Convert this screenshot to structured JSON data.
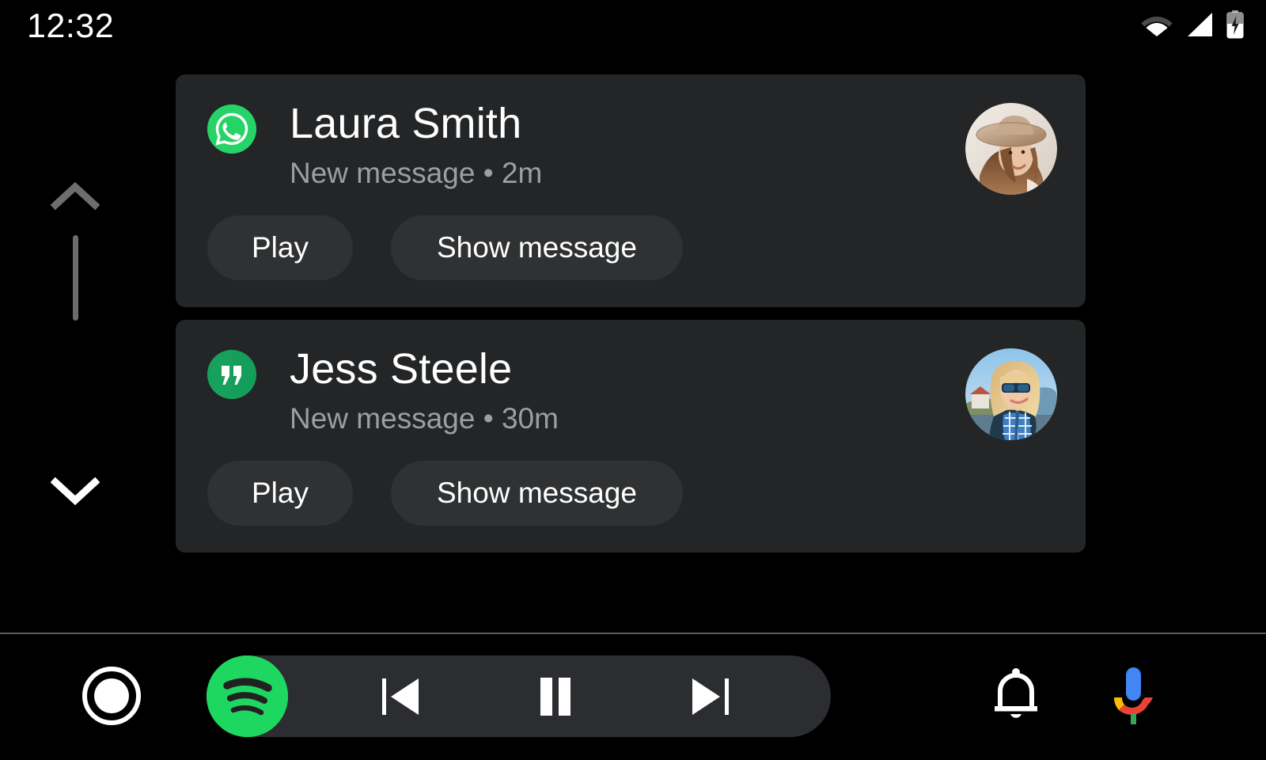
{
  "status_bar": {
    "time": "12:32",
    "icons": [
      {
        "name": "wifi-icon",
        "label": "Wi-Fi"
      },
      {
        "name": "cellular-signal-icon",
        "label": "Cellular signal"
      },
      {
        "name": "battery-charging-icon",
        "label": "Battery charging"
      }
    ]
  },
  "scroll": {
    "up_icon": "chevron-up-icon",
    "down_icon": "chevron-down-icon",
    "up_enabled": false,
    "down_enabled": true
  },
  "notifications": [
    {
      "sender": "Laura Smith",
      "subtitle": "New message • 2m",
      "status": "New message",
      "time": "2m",
      "app": "whatsapp",
      "app_icon": "whatsapp-icon",
      "app_color": "#25D366",
      "avatar_name": "avatar-laura-smith",
      "actions": [
        {
          "label": "Play",
          "name": "play-button"
        },
        {
          "label": "Show message",
          "name": "show-message-button"
        }
      ]
    },
    {
      "sender": "Jess Steele",
      "subtitle": "New message • 30m",
      "status": "New message",
      "time": "30m",
      "app": "hangouts",
      "app_icon": "hangouts-icon",
      "app_color": "#0F9D58",
      "avatar_name": "avatar-jess-steele",
      "actions": [
        {
          "label": "Play",
          "name": "play-button"
        },
        {
          "label": "Show message",
          "name": "show-message-button"
        }
      ]
    }
  ],
  "bottom_bar": {
    "home": {
      "name": "home-button",
      "icon": "home-circle-icon"
    },
    "media": {
      "app_icon": "spotify-icon",
      "app_color": "#1ED760",
      "previous": {
        "name": "previous-track-button",
        "icon": "skip-previous-icon"
      },
      "pause": {
        "name": "pause-button",
        "icon": "pause-icon"
      },
      "next": {
        "name": "next-track-button",
        "icon": "skip-next-icon"
      }
    },
    "notifications_button": {
      "name": "notifications-button",
      "icon": "bell-icon"
    },
    "assistant_button": {
      "name": "assistant-button",
      "icon": "microphone-icon"
    }
  },
  "colors": {
    "background": "#000000",
    "card": "#232527",
    "action_button": "#2F3133",
    "media_pill": "#2B2D30",
    "primary_text": "#FFFFFF",
    "secondary_text": "#9B9FA2",
    "divider": "#5A5A5A"
  }
}
